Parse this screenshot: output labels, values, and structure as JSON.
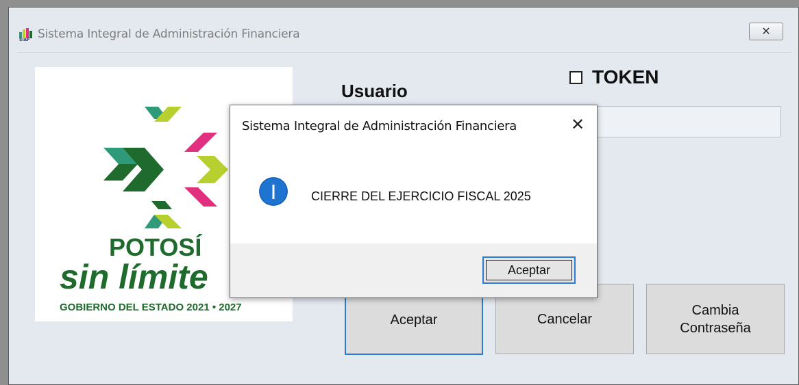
{
  "window": {
    "title": "Sistema Integral de Administración Financiera",
    "close_symbol": "✕",
    "app_icon": "siaf-logo-icon"
  },
  "logo": {
    "line1": "POTOSÍ",
    "line2": "sin límite",
    "line3": "GOBIERNO DEL ESTADO 2021 • 2027"
  },
  "form": {
    "usuario_label": "Usuario",
    "token_label": "TOKEN",
    "token_checked": false,
    "usuario_value": ""
  },
  "buttons": {
    "aceptar": "Aceptar",
    "cancelar": "Cancelar",
    "cambia_line1": "Cambia",
    "cambia_line2": "Contraseña"
  },
  "dialog": {
    "title": "Sistema Integral de Administración Financiera",
    "close_symbol": "✕",
    "icon": "info-icon",
    "message": "CIERRE DEL EJERCICIO FISCAL 2025",
    "ok_label": "Aceptar"
  },
  "colors": {
    "accent_blue": "#2a7bd3",
    "logo_green_dark": "#1f6b2d",
    "logo_green_light": "#b7cf2f",
    "logo_magenta": "#e0307f",
    "logo_teal": "#2e9a7a"
  }
}
